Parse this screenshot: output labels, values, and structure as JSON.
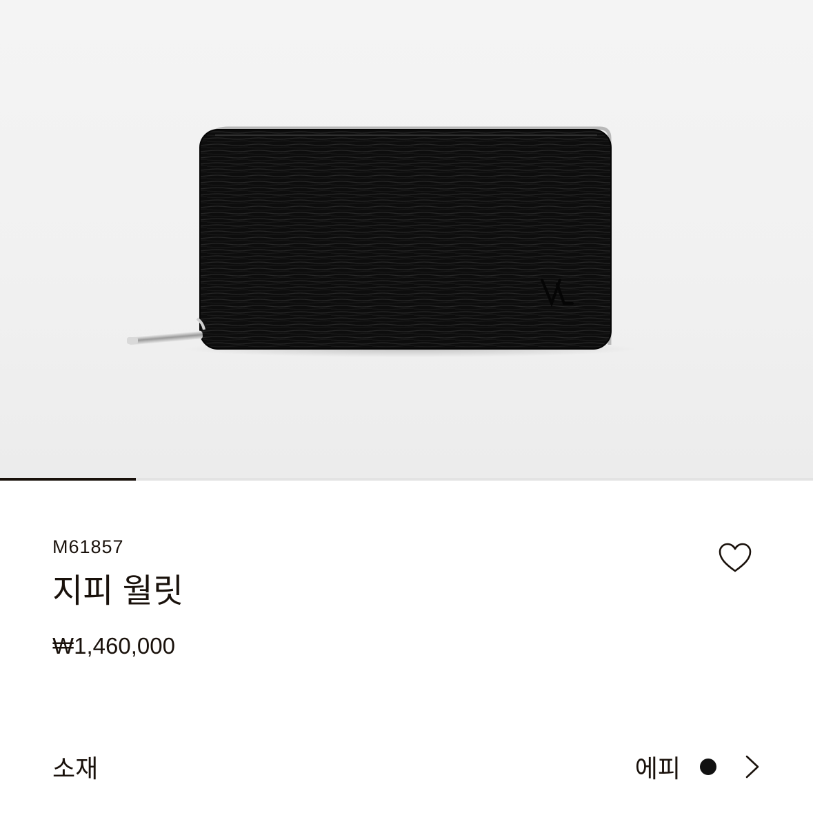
{
  "product": {
    "sku": "M61857",
    "name": "지피 월릿",
    "price": "₩1,460,000"
  },
  "gallery": {
    "current_index": 1,
    "total_images": 6,
    "progress_fraction": 0.1667
  },
  "material": {
    "label": "소재",
    "value": "에피",
    "swatch_color": "#111111"
  },
  "icons": {
    "wishlist": "heart-outline-icon",
    "material_more": "chevron-right-icon",
    "wallet_logo": "lv-monogram-icon"
  },
  "colors": {
    "text": "#19110b",
    "hero_background": "#f2f2f2",
    "progress_track": "#e3e3e3",
    "progress_fill": "#19110b"
  }
}
